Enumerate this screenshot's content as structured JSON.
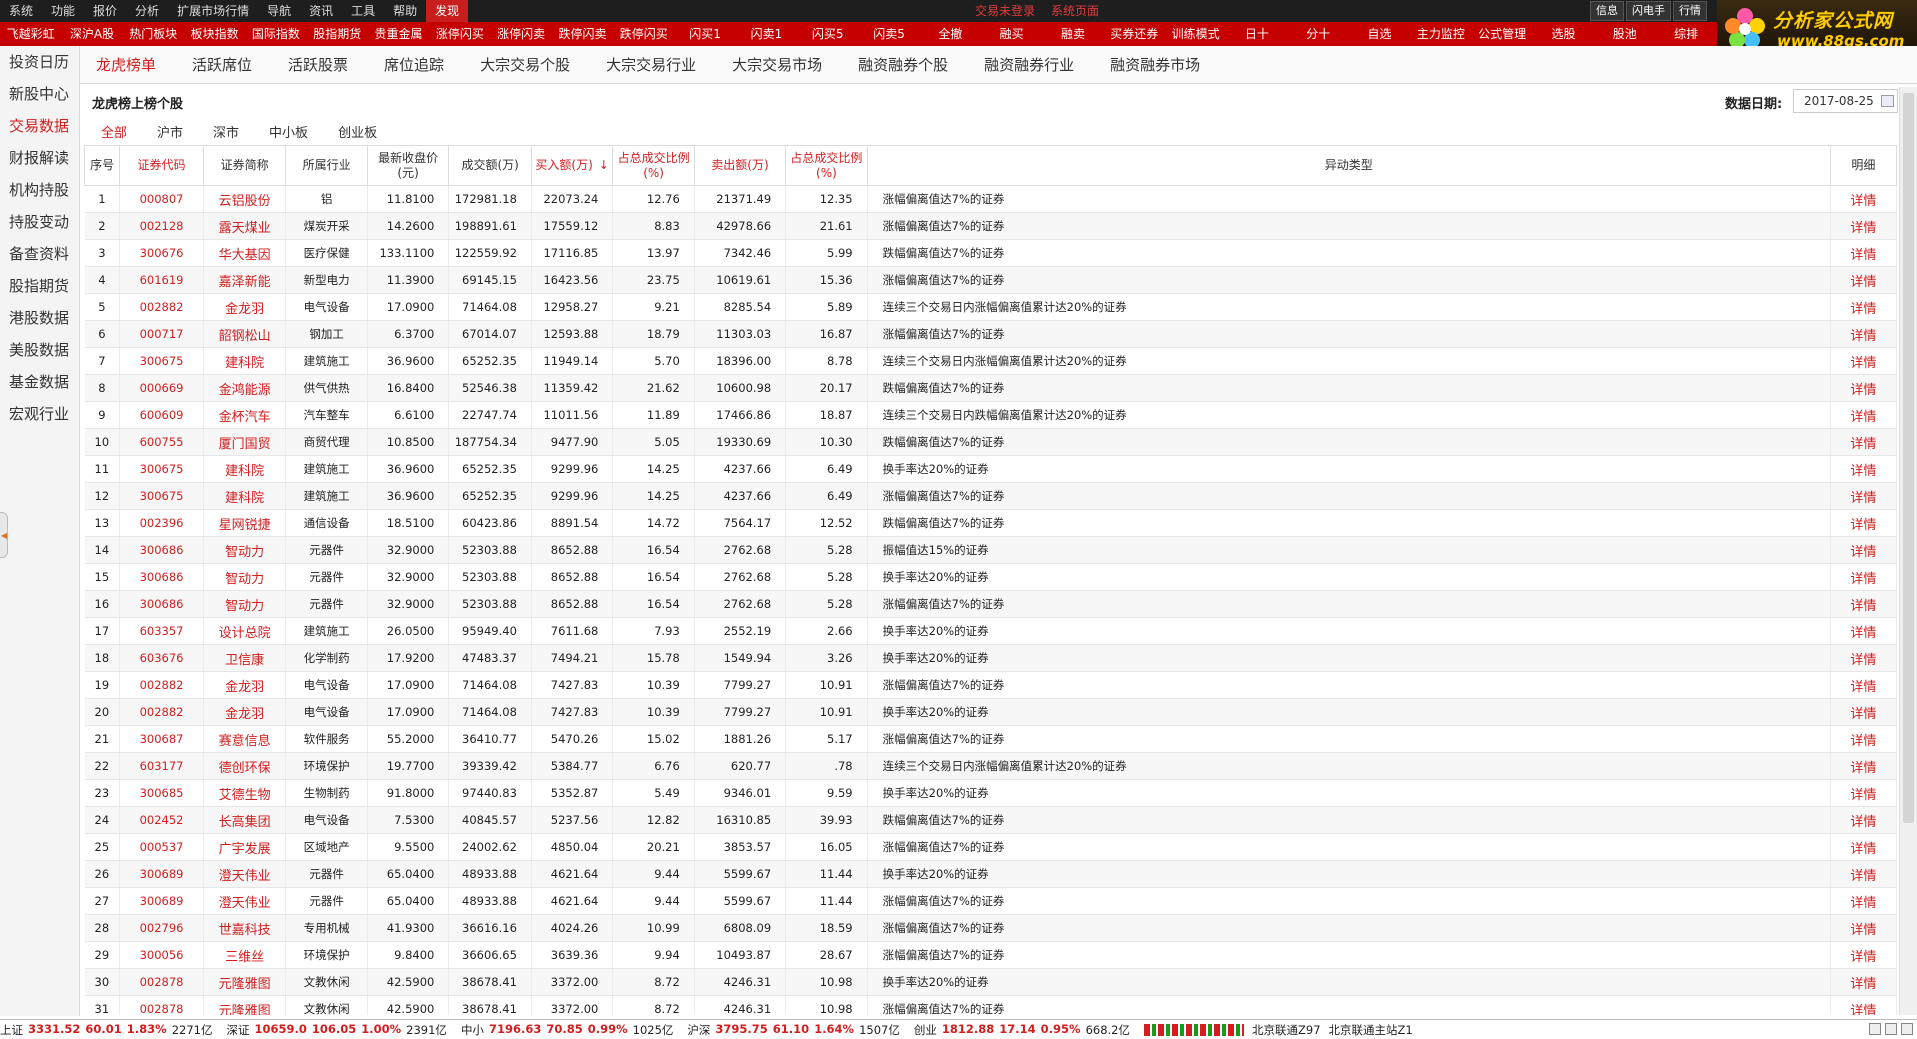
{
  "menubar": {
    "items": [
      "系统",
      "功能",
      "报价",
      "分析",
      "扩展市场行情",
      "导航",
      "资讯",
      "工具",
      "帮助",
      "发现"
    ],
    "active_index": 9,
    "center": [
      "交易未登录",
      "系统页面"
    ],
    "right_tabs": [
      "信息",
      "闪电手",
      "行情"
    ]
  },
  "funcbar": {
    "items": [
      "飞越彩虹",
      "深沪A股",
      "热门板块",
      "板块指数",
      "国际指数",
      "股指期货",
      "贵重金属",
      "涨停闪买",
      "涨停闪卖",
      "跌停闪卖",
      "跌停闪买",
      "闪买1",
      "闪卖1",
      "闪买5",
      "闪卖5",
      "全撤",
      "融买",
      "融卖",
      "买券还券",
      "训练模式",
      "日十",
      "分十",
      "自选",
      "主力监控",
      "公式管理",
      "选股",
      "股池",
      "综排"
    ]
  },
  "logo": {
    "cn": "分析家公式网",
    "url": "www.88gs.com"
  },
  "sidebar": {
    "items": [
      "投资日历",
      "新股中心",
      "交易数据",
      "财报解读",
      "机构持股",
      "持股变动",
      "备查资料",
      "股指期货",
      "港股数据",
      "美股数据",
      "基金数据",
      "宏观行业"
    ],
    "active_index": 2
  },
  "subtabs": {
    "items": [
      "龙虎榜单",
      "活跃席位",
      "活跃股票",
      "席位追踪",
      "大宗交易个股",
      "大宗交易行业",
      "大宗交易市场",
      "融资融券个股",
      "融资融券行业",
      "融资融券市场"
    ],
    "active_index": 0
  },
  "panel": {
    "title": "龙虎榜上榜个股",
    "date_label": "数据日期:",
    "date_value": "2017-08-25"
  },
  "market_tabs": {
    "items": [
      "全部",
      "沪市",
      "深市",
      "中小板",
      "创业板"
    ],
    "active_index": 0
  },
  "table": {
    "sort_indicator": "↓",
    "columns": [
      {
        "label": "序号",
        "red": false
      },
      {
        "label": "证券代码",
        "red": true
      },
      {
        "label": "证券简称",
        "red": false
      },
      {
        "label": "所属行业",
        "red": false
      },
      {
        "label": "最新收盘价(元)",
        "red": false
      },
      {
        "label": "成交额(万)",
        "red": false
      },
      {
        "label": "买入额(万)",
        "red": true
      },
      {
        "label": "占总成交比例(%)",
        "red": true
      },
      {
        "label": "卖出额(万)",
        "red": true
      },
      {
        "label": "占总成交比例(%)",
        "red": true
      },
      {
        "label": "异动类型",
        "red": false
      },
      {
        "label": "明细",
        "red": false
      }
    ],
    "detail_label": "详情",
    "rows": [
      [
        "1",
        "000807",
        "云铝股份",
        "铝",
        "11.8100",
        "172981.18",
        "22073.24",
        "12.76",
        "21371.49",
        "12.35",
        "涨幅偏离值达7%的证券"
      ],
      [
        "2",
        "002128",
        "露天煤业",
        "煤炭开采",
        "14.2600",
        "198891.61",
        "17559.12",
        "8.83",
        "42978.66",
        "21.61",
        "涨幅偏离值达7%的证券"
      ],
      [
        "3",
        "300676",
        "华大基因",
        "医疗保健",
        "133.1100",
        "122559.92",
        "17116.85",
        "13.97",
        "7342.46",
        "5.99",
        "跌幅偏离值达7%的证券"
      ],
      [
        "4",
        "601619",
        "嘉泽新能",
        "新型电力",
        "11.3900",
        "69145.15",
        "16423.56",
        "23.75",
        "10619.61",
        "15.36",
        "涨幅偏离值达7%的证券"
      ],
      [
        "5",
        "002882",
        "金龙羽",
        "电气设备",
        "17.0900",
        "71464.08",
        "12958.27",
        "9.21",
        "8285.54",
        "5.89",
        "连续三个交易日内涨幅偏离值累计达20%的证券"
      ],
      [
        "6",
        "000717",
        "韶钢松山",
        "钢加工",
        "6.3700",
        "67014.07",
        "12593.88",
        "18.79",
        "11303.03",
        "16.87",
        "涨幅偏离值达7%的证券"
      ],
      [
        "7",
        "300675",
        "建科院",
        "建筑施工",
        "36.9600",
        "65252.35",
        "11949.14",
        "5.70",
        "18396.00",
        "8.78",
        "连续三个交易日内涨幅偏离值累计达20%的证券"
      ],
      [
        "8",
        "000669",
        "金鸿能源",
        "供气供热",
        "16.8400",
        "52546.38",
        "11359.42",
        "21.62",
        "10600.98",
        "20.17",
        "跌幅偏离值达7%的证券"
      ],
      [
        "9",
        "600609",
        "金杯汽车",
        "汽车整车",
        "6.6100",
        "22747.74",
        "11011.56",
        "11.89",
        "17466.86",
        "18.87",
        "连续三个交易日内跌幅偏离值累计达20%的证券"
      ],
      [
        "10",
        "600755",
        "厦门国贸",
        "商贸代理",
        "10.8500",
        "187754.34",
        "9477.90",
        "5.05",
        "19330.69",
        "10.30",
        "跌幅偏离值达7%的证券"
      ],
      [
        "11",
        "300675",
        "建科院",
        "建筑施工",
        "36.9600",
        "65252.35",
        "9299.96",
        "14.25",
        "4237.66",
        "6.49",
        "换手率达20%的证券"
      ],
      [
        "12",
        "300675",
        "建科院",
        "建筑施工",
        "36.9600",
        "65252.35",
        "9299.96",
        "14.25",
        "4237.66",
        "6.49",
        "涨幅偏离值达7%的证券"
      ],
      [
        "13",
        "002396",
        "星网锐捷",
        "通信设备",
        "18.5100",
        "60423.86",
        "8891.54",
        "14.72",
        "7564.17",
        "12.52",
        "跌幅偏离值达7%的证券"
      ],
      [
        "14",
        "300686",
        "智动力",
        "元器件",
        "32.9000",
        "52303.88",
        "8652.88",
        "16.54",
        "2762.68",
        "5.28",
        "振幅值达15%的证券"
      ],
      [
        "15",
        "300686",
        "智动力",
        "元器件",
        "32.9000",
        "52303.88",
        "8652.88",
        "16.54",
        "2762.68",
        "5.28",
        "换手率达20%的证券"
      ],
      [
        "16",
        "300686",
        "智动力",
        "元器件",
        "32.9000",
        "52303.88",
        "8652.88",
        "16.54",
        "2762.68",
        "5.28",
        "涨幅偏离值达7%的证券"
      ],
      [
        "17",
        "603357",
        "设计总院",
        "建筑施工",
        "26.0500",
        "95949.40",
        "7611.68",
        "7.93",
        "2552.19",
        "2.66",
        "换手率达20%的证券"
      ],
      [
        "18",
        "603676",
        "卫信康",
        "化学制药",
        "17.9200",
        "47483.37",
        "7494.21",
        "15.78",
        "1549.94",
        "3.26",
        "换手率达20%的证券"
      ],
      [
        "19",
        "002882",
        "金龙羽",
        "电气设备",
        "17.0900",
        "71464.08",
        "7427.83",
        "10.39",
        "7799.27",
        "10.91",
        "涨幅偏离值达7%的证券"
      ],
      [
        "20",
        "002882",
        "金龙羽",
        "电气设备",
        "17.0900",
        "71464.08",
        "7427.83",
        "10.39",
        "7799.27",
        "10.91",
        "换手率达20%的证券"
      ],
      [
        "21",
        "300687",
        "赛意信息",
        "软件服务",
        "55.2000",
        "36410.77",
        "5470.26",
        "15.02",
        "1881.26",
        "5.17",
        "涨幅偏离值达7%的证券"
      ],
      [
        "22",
        "603177",
        "德创环保",
        "环境保护",
        "19.7700",
        "39339.42",
        "5384.77",
        "6.76",
        "620.77",
        ".78",
        "连续三个交易日内涨幅偏离值累计达20%的证券"
      ],
      [
        "23",
        "300685",
        "艾德生物",
        "生物制药",
        "91.8000",
        "97440.83",
        "5352.87",
        "5.49",
        "9346.01",
        "9.59",
        "换手率达20%的证券"
      ],
      [
        "24",
        "002452",
        "长高集团",
        "电气设备",
        "7.5300",
        "40845.57",
        "5237.56",
        "12.82",
        "16310.85",
        "39.93",
        "跌幅偏离值达7%的证券"
      ],
      [
        "25",
        "000537",
        "广宇发展",
        "区域地产",
        "9.5500",
        "24002.62",
        "4850.04",
        "20.21",
        "3853.57",
        "16.05",
        "涨幅偏离值达7%的证券"
      ],
      [
        "26",
        "300689",
        "澄天伟业",
        "元器件",
        "65.0400",
        "48933.88",
        "4621.64",
        "9.44",
        "5599.67",
        "11.44",
        "换手率达20%的证券"
      ],
      [
        "27",
        "300689",
        "澄天伟业",
        "元器件",
        "65.0400",
        "48933.88",
        "4621.64",
        "9.44",
        "5599.67",
        "11.44",
        "涨幅偏离值达7%的证券"
      ],
      [
        "28",
        "002796",
        "世嘉科技",
        "专用机械",
        "41.9300",
        "36616.16",
        "4024.26",
        "10.99",
        "6808.09",
        "18.59",
        "涨幅偏离值达7%的证券"
      ],
      [
        "29",
        "300056",
        "三维丝",
        "环境保护",
        "9.8400",
        "36606.65",
        "3639.36",
        "9.94",
        "10493.87",
        "28.67",
        "涨幅偏离值达7%的证券"
      ],
      [
        "30",
        "002878",
        "元隆雅图",
        "文教休闲",
        "42.5900",
        "38678.41",
        "3372.00",
        "8.72",
        "4246.31",
        "10.98",
        "换手率达20%的证券"
      ],
      [
        "31",
        "002878",
        "元隆雅图",
        "文教休闲",
        "42.5900",
        "38678.41",
        "3372.00",
        "8.72",
        "4246.31",
        "10.98",
        "涨幅偏离值达7%的证券"
      ]
    ]
  },
  "statusbar": {
    "indices": [
      {
        "name": "上证",
        "value": "3331.52",
        "chg": "60.01",
        "pct": "1.83%",
        "vol": "2271亿"
      },
      {
        "name": "深证",
        "value": "10659.0",
        "chg": "106.05",
        "pct": "1.00%",
        "vol": "2391亿"
      },
      {
        "name": "中小",
        "value": "7196.63",
        "chg": "70.85",
        "pct": "0.99%",
        "vol": "1025亿"
      },
      {
        "name": "沪深",
        "value": "3795.75",
        "chg": "61.10",
        "pct": "1.64%",
        "vol": "1507亿"
      },
      {
        "name": "创业",
        "value": "1812.88",
        "chg": "17.14",
        "pct": "0.95%",
        "vol": "668.2亿"
      }
    ],
    "connections": [
      "北京联通Z97",
      "北京联通主站Z1"
    ]
  },
  "colors": {
    "accent_red": "#d21e1e",
    "func_bar": "#c60000",
    "menu_bg": "#1e1e1e"
  }
}
